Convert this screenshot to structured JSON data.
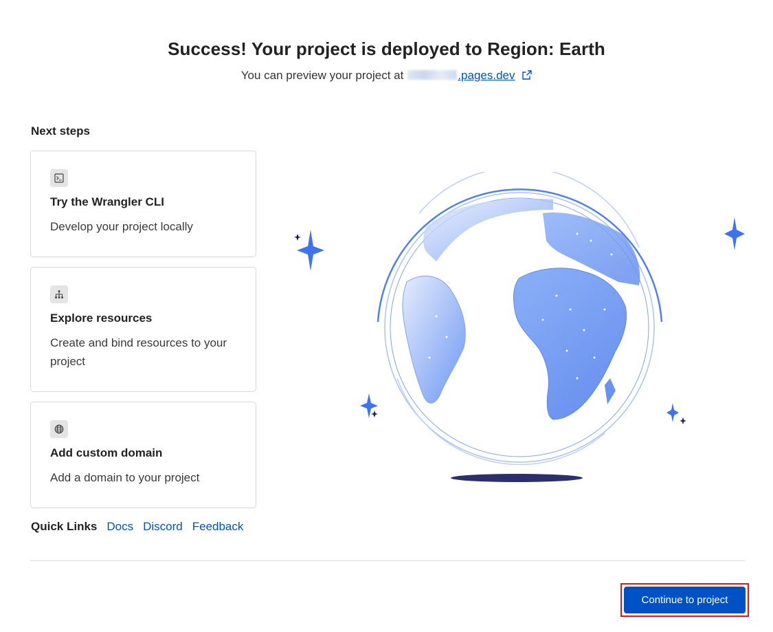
{
  "header": {
    "title": "Success! Your project is deployed to Region: Earth",
    "preview_prefix": "You can preview your project at",
    "preview_link": ".pages.dev"
  },
  "next_steps": {
    "heading": "Next steps",
    "cards": [
      {
        "icon": "terminal-icon",
        "title": "Try the Wrangler CLI",
        "description": "Develop your project locally"
      },
      {
        "icon": "hierarchy-icon",
        "title": "Explore resources",
        "description": "Create and bind resources to your project"
      },
      {
        "icon": "globe-icon",
        "title": "Add custom domain",
        "description": "Add a domain to your project"
      }
    ]
  },
  "quick_links": {
    "label": "Quick Links",
    "links": [
      "Docs",
      "Discord",
      "Feedback"
    ]
  },
  "footer": {
    "continue_label": "Continue to project"
  },
  "colors": {
    "accent": "#0051c3",
    "highlight": "#e0141e",
    "globe_blue": "#4d7ff0"
  },
  "illustration": {
    "icon": "earth-globe-illustration"
  }
}
